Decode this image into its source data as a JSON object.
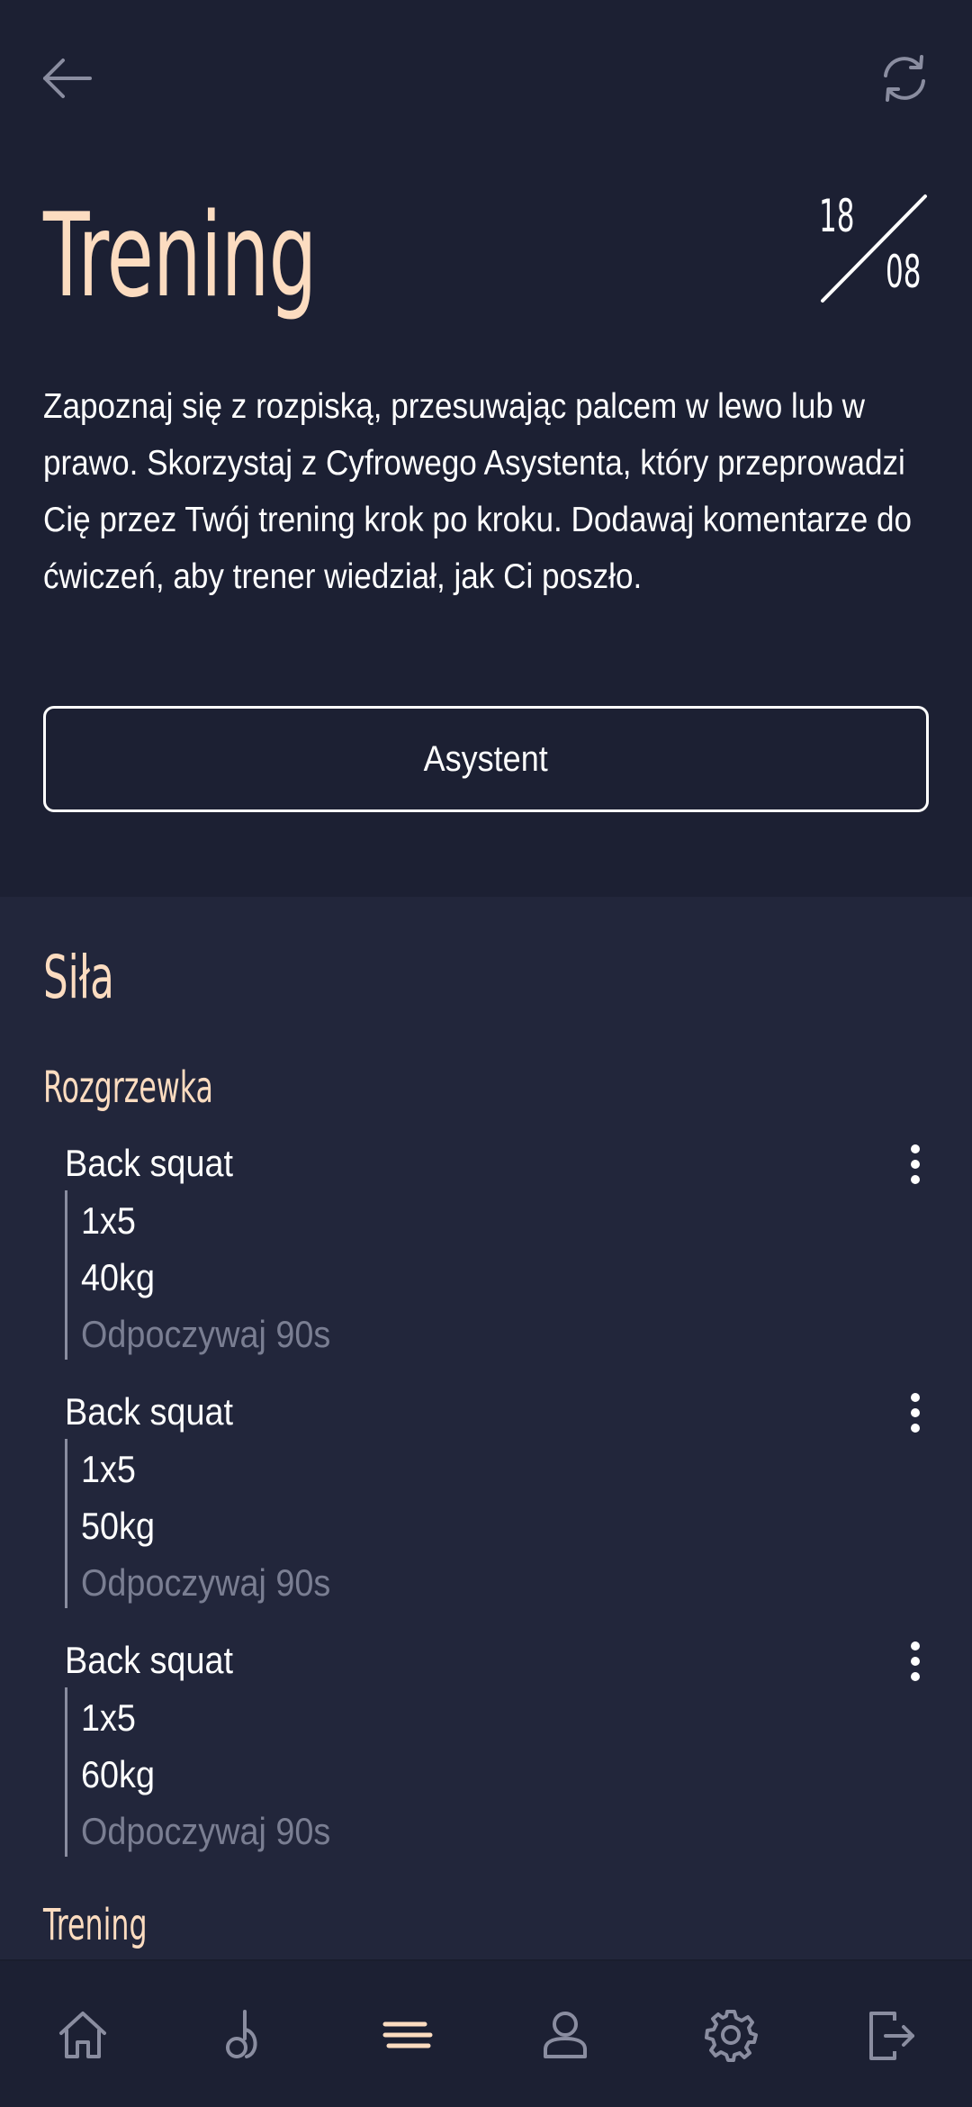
{
  "header": {
    "title": "Trening",
    "date_day": "18",
    "date_month": "08",
    "intro_text": "Zapoznaj się z rozpiską, przesuwając palcem w lewo lub w prawo. Skorzystaj z Cyfrowego Asystenta, który przeprowadzi Cię przez Twój trening krok po kroku. Dodawaj komentarze do ćwiczeń, aby trener wiedział, jak Ci poszło.",
    "assistant_button": "Asystent"
  },
  "workout": {
    "section_title": "Siła",
    "warmup_title": "Rozgrzewka",
    "exercises": [
      {
        "name": "Back squat",
        "sets": "1x5",
        "weight": "40kg",
        "rest": "Odpoczywaj 90s"
      },
      {
        "name": "Back squat",
        "sets": "1x5",
        "weight": "50kg",
        "rest": "Odpoczywaj 90s"
      },
      {
        "name": "Back squat",
        "sets": "1x5",
        "weight": "60kg",
        "rest": "Odpoczywaj 90s"
      }
    ],
    "next_title": "Trening"
  },
  "nav": {
    "items": [
      {
        "icon": "home-icon",
        "active": false
      },
      {
        "icon": "kettlebell-icon",
        "active": false
      },
      {
        "icon": "menu-lines-icon",
        "active": true
      },
      {
        "icon": "user-icon",
        "active": false
      },
      {
        "icon": "gear-icon",
        "active": false
      },
      {
        "icon": "logout-icon",
        "active": false
      }
    ]
  },
  "colors": {
    "background": "#1c2033",
    "section_background": "#22263b",
    "accent": "#fcdcc0",
    "text": "#ffffff",
    "muted_text": "#7a7e92",
    "icon": "#8a8da0"
  }
}
